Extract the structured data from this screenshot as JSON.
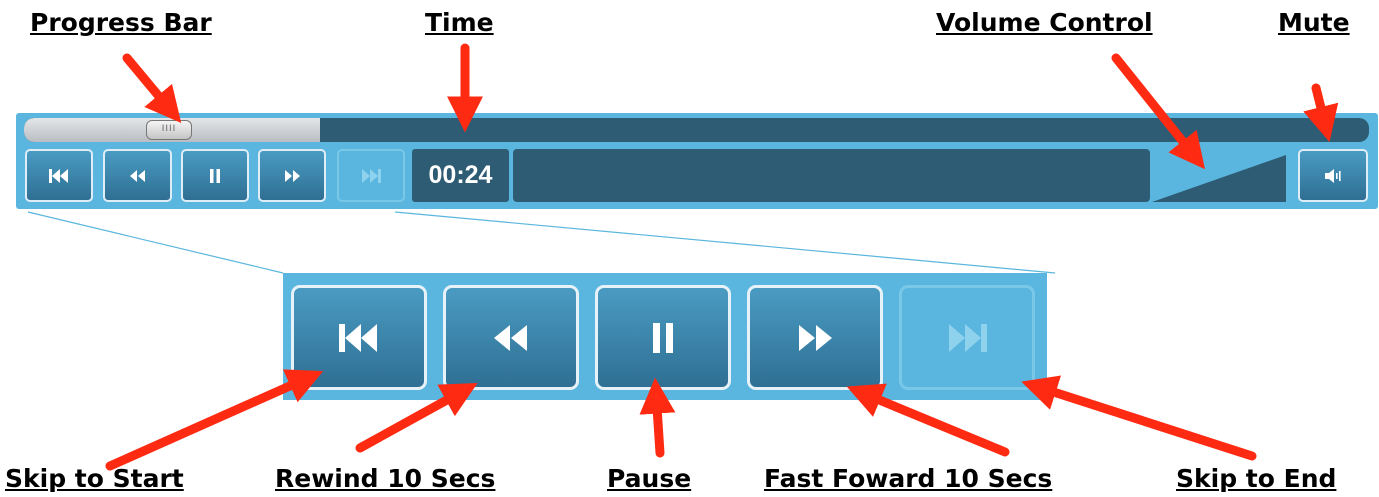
{
  "labels": {
    "progress_bar": "Progress Bar",
    "time": "Time",
    "volume_control": "Volume Control",
    "mute": "Mute",
    "skip_to_start": "Skip to Start",
    "rewind": "Rewind 10 Secs",
    "pause": "Pause",
    "fast_forward": "Fast Foward 10 Secs",
    "skip_to_end": "Skip to End"
  },
  "player": {
    "time_display": "00:24",
    "progress_fraction": 0.22,
    "thumb_grip": "IIII"
  },
  "colors": {
    "panel": "#5ab6de",
    "dark": "#2e5c74",
    "arrow": "#ff2a12"
  },
  "icons": [
    "skip-start-icon",
    "rewind-icon",
    "pause-icon",
    "fast-forward-icon",
    "skip-end-icon",
    "volume-icon"
  ]
}
